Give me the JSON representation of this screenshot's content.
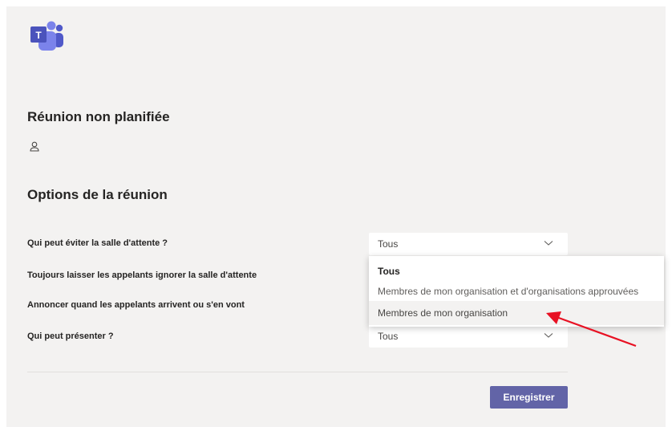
{
  "meeting": {
    "title": "Réunion non planifiée"
  },
  "options": {
    "section_title": "Options de la réunion",
    "items": [
      {
        "label": "Qui peut éviter la salle d'attente ?",
        "value": "Tous"
      },
      {
        "label": "Toujours laisser les appelants ignorer la salle d'attente"
      },
      {
        "label": "Annoncer quand les appelants arrivent ou s'en vont"
      },
      {
        "label": "Qui peut présenter ?",
        "value": "Tous"
      }
    ]
  },
  "dropdown": {
    "options": [
      "Tous",
      "Membres de mon organisation et d'organisations approuvées",
      "Membres de mon organisation"
    ],
    "selected": "Tous",
    "hovered": "Membres de mon organisation"
  },
  "actions": {
    "save_label": "Enregistrer"
  },
  "colors": {
    "accent": "#6264a7",
    "background": "#f3f2f1",
    "annotation_arrow": "#e81123"
  },
  "icons": {
    "logo": "microsoft-teams-logo",
    "organizer": "person-icon",
    "chevron": "chevron-down-icon"
  }
}
